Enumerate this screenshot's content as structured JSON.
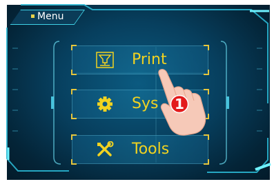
{
  "header": {
    "menu_label": "Menu",
    "icon": "menu-dot-icon"
  },
  "menu": {
    "items": [
      {
        "label": "Print",
        "icon": "print-nozzle-icon"
      },
      {
        "label": "Sys",
        "icon": "gear-icon"
      },
      {
        "label": "Tools",
        "icon": "tools-icon"
      }
    ]
  },
  "annotation": {
    "step_number": "1"
  },
  "colors": {
    "accent": "#f2d320",
    "frame_line": "#3fd3e8",
    "background": "#063a55",
    "callout": "#e31b1b"
  }
}
